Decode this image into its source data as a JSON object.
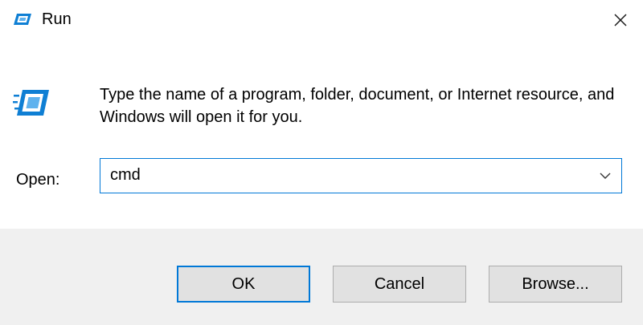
{
  "window": {
    "title": "Run",
    "title_icon": "run-icon",
    "close_icon": "close-icon"
  },
  "content": {
    "icon": "run-icon",
    "description": "Type the name of a program, folder, document, or Internet resource, and Windows will open it for you.",
    "open_label": "Open:",
    "open_value": "cmd",
    "dropdown_icon": "chevron-down-icon"
  },
  "buttons": {
    "ok": "OK",
    "cancel": "Cancel",
    "browse": "Browse..."
  },
  "colors": {
    "accent": "#0078d7",
    "footer_bg": "#f0f0f0",
    "button_bg": "#e1e1e1",
    "button_border": "#adadad"
  }
}
